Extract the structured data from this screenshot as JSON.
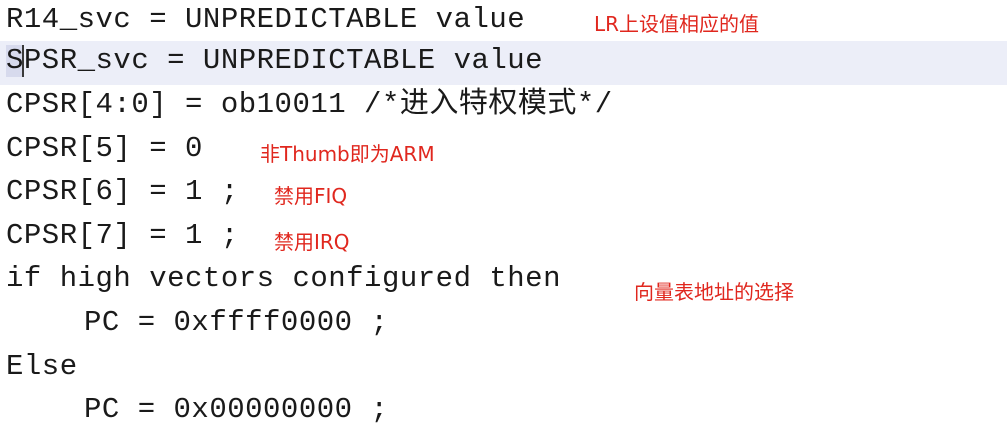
{
  "code_lines": [
    {
      "text": "R14_svc = UNPREDICTABLE value",
      "note": "LR上设值相应的值"
    },
    {
      "text": "SPSR_svc = UNPREDICTABLE value",
      "note": ""
    },
    {
      "text": "CPSR[4:0] = ob10011 /*进入特权模式*/",
      "note": ""
    },
    {
      "text": "CPSR[5] = 0",
      "note": "非Thumb即为ARM"
    },
    {
      "text": "CPSR[6] = 1 ;",
      "note": "禁用FIQ"
    },
    {
      "text": "CPSR[7] = 1 ;",
      "note": "禁用IRQ"
    },
    {
      "text": "if high vectors configured then",
      "note": "向量表地址的选择"
    },
    {
      "text": "PC = 0xffff0000 ;",
      "note": ""
    },
    {
      "text": "Else",
      "note": ""
    },
    {
      "text": "PC = 0x00000000 ;",
      "note": ""
    }
  ]
}
